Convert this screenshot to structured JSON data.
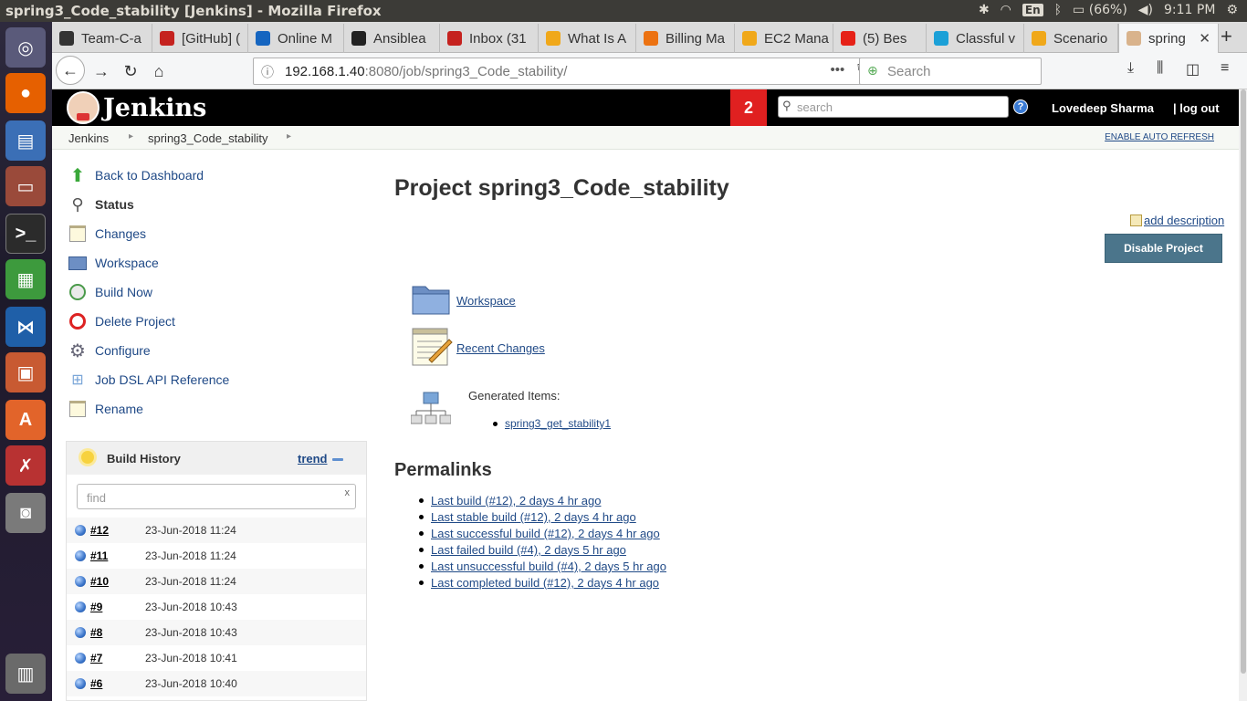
{
  "window": {
    "title": "spring3_Code_stability [Jenkins] - Mozilla Firefox",
    "tray": {
      "lang": "En",
      "battery": "(66%)",
      "time": "9:11 PM"
    }
  },
  "tabs": [
    {
      "label": "Team-C-a",
      "color": "#333333"
    },
    {
      "label": "[GitHub] (",
      "color": "#c5221f"
    },
    {
      "label": "Online M",
      "color": "#1565c0"
    },
    {
      "label": "Ansiblea",
      "color": "#222222"
    },
    {
      "label": "Inbox (31",
      "color": "#c5221f"
    },
    {
      "label": "What Is A",
      "color": "#f0a81a"
    },
    {
      "label": "Billing Ma",
      "color": "#ec7211"
    },
    {
      "label": "EC2 Mana",
      "color": "#f0a81a"
    },
    {
      "label": "(5) Bes",
      "color": "#e62117"
    },
    {
      "label": "Classful v",
      "color": "#1ba0d7"
    },
    {
      "label": "Scenario",
      "color": "#f0a81a"
    },
    {
      "label": "spring",
      "color": "#d9b38c"
    }
  ],
  "browser": {
    "url_host": "192.168.1.40",
    "url_rest": ":8080/job/spring3_Code_stability/",
    "search_placeholder": "Search"
  },
  "jenkins": {
    "logo_text": "Jenkins",
    "notifications": "2",
    "search_placeholder": "search",
    "user": "Lovedeep Sharma",
    "logout": "| log out"
  },
  "breadcrumb": {
    "items": [
      "Jenkins",
      "spring3_Code_stability"
    ],
    "auto_refresh": "ENABLE AUTO REFRESH"
  },
  "sidebar": {
    "tasks": [
      {
        "label": "Back to Dashboard",
        "icon": "up-arrow-icon"
      },
      {
        "label": "Status",
        "icon": "magnifier-icon"
      },
      {
        "label": "Changes",
        "icon": "notepad-icon"
      },
      {
        "label": "Workspace",
        "icon": "folder-icon"
      },
      {
        "label": "Build Now",
        "icon": "clock-icon"
      },
      {
        "label": "Delete Project",
        "icon": "no-entry-icon"
      },
      {
        "label": "Configure",
        "icon": "gear-icon"
      },
      {
        "label": "Job DSL API Reference",
        "icon": "network-icon"
      },
      {
        "label": "Rename",
        "icon": "notepad-icon"
      }
    ]
  },
  "build_history": {
    "title": "Build History",
    "trend": "trend",
    "find_placeholder": "find",
    "find_clear": "x",
    "builds": [
      {
        "num": "#12",
        "date": "23-Jun-2018 11:24"
      },
      {
        "num": "#11",
        "date": "23-Jun-2018 11:24"
      },
      {
        "num": "#10",
        "date": "23-Jun-2018 11:24"
      },
      {
        "num": "#9",
        "date": "23-Jun-2018 10:43"
      },
      {
        "num": "#8",
        "date": "23-Jun-2018 10:43"
      },
      {
        "num": "#7",
        "date": "23-Jun-2018 10:41"
      },
      {
        "num": "#6",
        "date": "23-Jun-2018 10:40"
      }
    ]
  },
  "main": {
    "title": "Project spring3_Code_stability",
    "add_description": "add description",
    "disable_button": "Disable Project",
    "workspace_link": "Workspace",
    "recent_changes_link": "Recent Changes",
    "generated_label": "Generated Items:",
    "generated_item": "spring3_get_stability1",
    "permalinks_title": "Permalinks",
    "permalinks": [
      "Last build (#12), 2 days 4 hr ago",
      "Last stable build (#12), 2 days 4 hr ago",
      "Last successful build (#12), 2 days 4 hr ago",
      "Last failed build (#4), 2 days 5 hr ago",
      "Last unsuccessful build (#4), 2 days 5 hr ago",
      "Last completed build (#12), 2 days 4 hr ago"
    ]
  }
}
